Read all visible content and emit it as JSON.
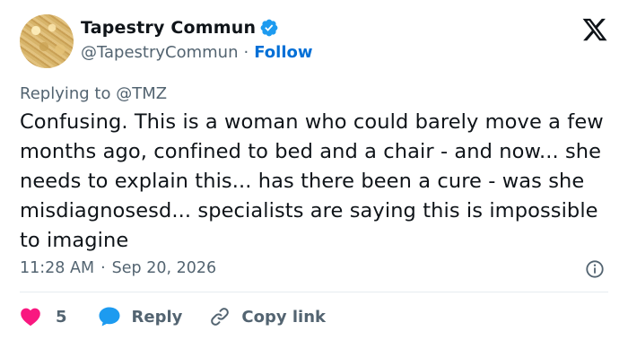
{
  "author": {
    "display_name": "Tapestry Commun",
    "handle": "@TapestryCommun",
    "follow_label": "Follow",
    "separator": "·"
  },
  "replying_to": "Replying to @TMZ",
  "tweet": {
    "text": "Confusing. This is a woman who could barely move a few months ago, confined to bed and a chair - and now... she needs to explain this... has there been a cure - was she misdiagnosesd... specialists are saying this is impossible to imagine"
  },
  "meta": {
    "time": "11:28 AM",
    "separator": "·",
    "date": "Sep 20, 2026"
  },
  "actions": {
    "likes_count": "5",
    "reply_label": "Reply",
    "copy_link_label": "Copy link"
  },
  "icons": {
    "verified": "verified-badge-icon",
    "logo": "x-logo-icon",
    "info": "info-icon",
    "like": "heart-icon",
    "reply": "reply-bubble-icon",
    "copy_link": "link-icon"
  },
  "colors": {
    "text": "#0f1419",
    "secondary": "#536471",
    "link": "#006fd6",
    "verified": "#1d9bf0",
    "heart": "#f91880",
    "reply": "#1d9bf0"
  }
}
